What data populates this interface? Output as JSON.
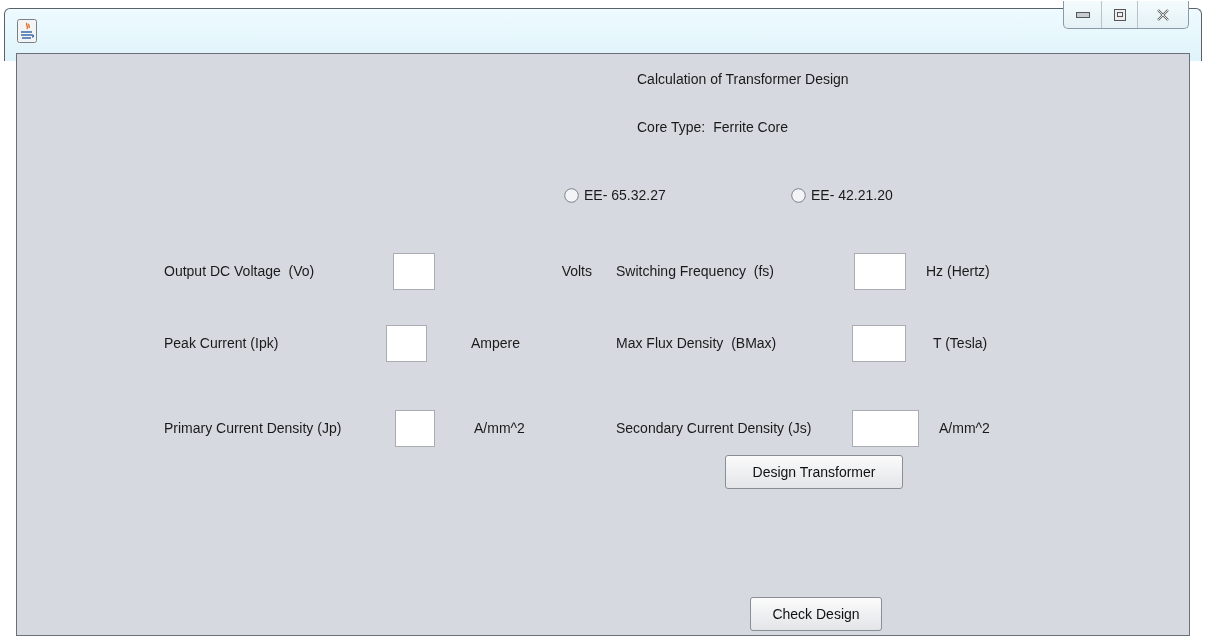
{
  "heading": "Calculation of Transformer Design",
  "core_type": {
    "label": "Core Type:",
    "value": "Ferrite Core"
  },
  "core_options": [
    {
      "label": "EE- 65.32.27",
      "selected": false
    },
    {
      "label": "EE- 42.21.20",
      "selected": false
    }
  ],
  "rows": [
    {
      "left": {
        "label": "Output DC Voltage  (Vo)",
        "unit": "Volts"
      },
      "right": {
        "label": "Switching Frequency  (fs)",
        "unit": "Hz (Hertz)"
      }
    },
    {
      "left": {
        "label": "Peak Current (Ipk)",
        "unit": "Ampere"
      },
      "right": {
        "label": "Max Flux Density  (BMax)",
        "unit": "T (Tesla)"
      }
    },
    {
      "left": {
        "label": "Primary Current Density (Jp)",
        "unit": "A/mm^2"
      },
      "right": {
        "label": "Secondary Current Density (Js)",
        "unit": "A/mm^2"
      }
    }
  ],
  "buttons": [
    "Design Transformer",
    "Check Design"
  ]
}
